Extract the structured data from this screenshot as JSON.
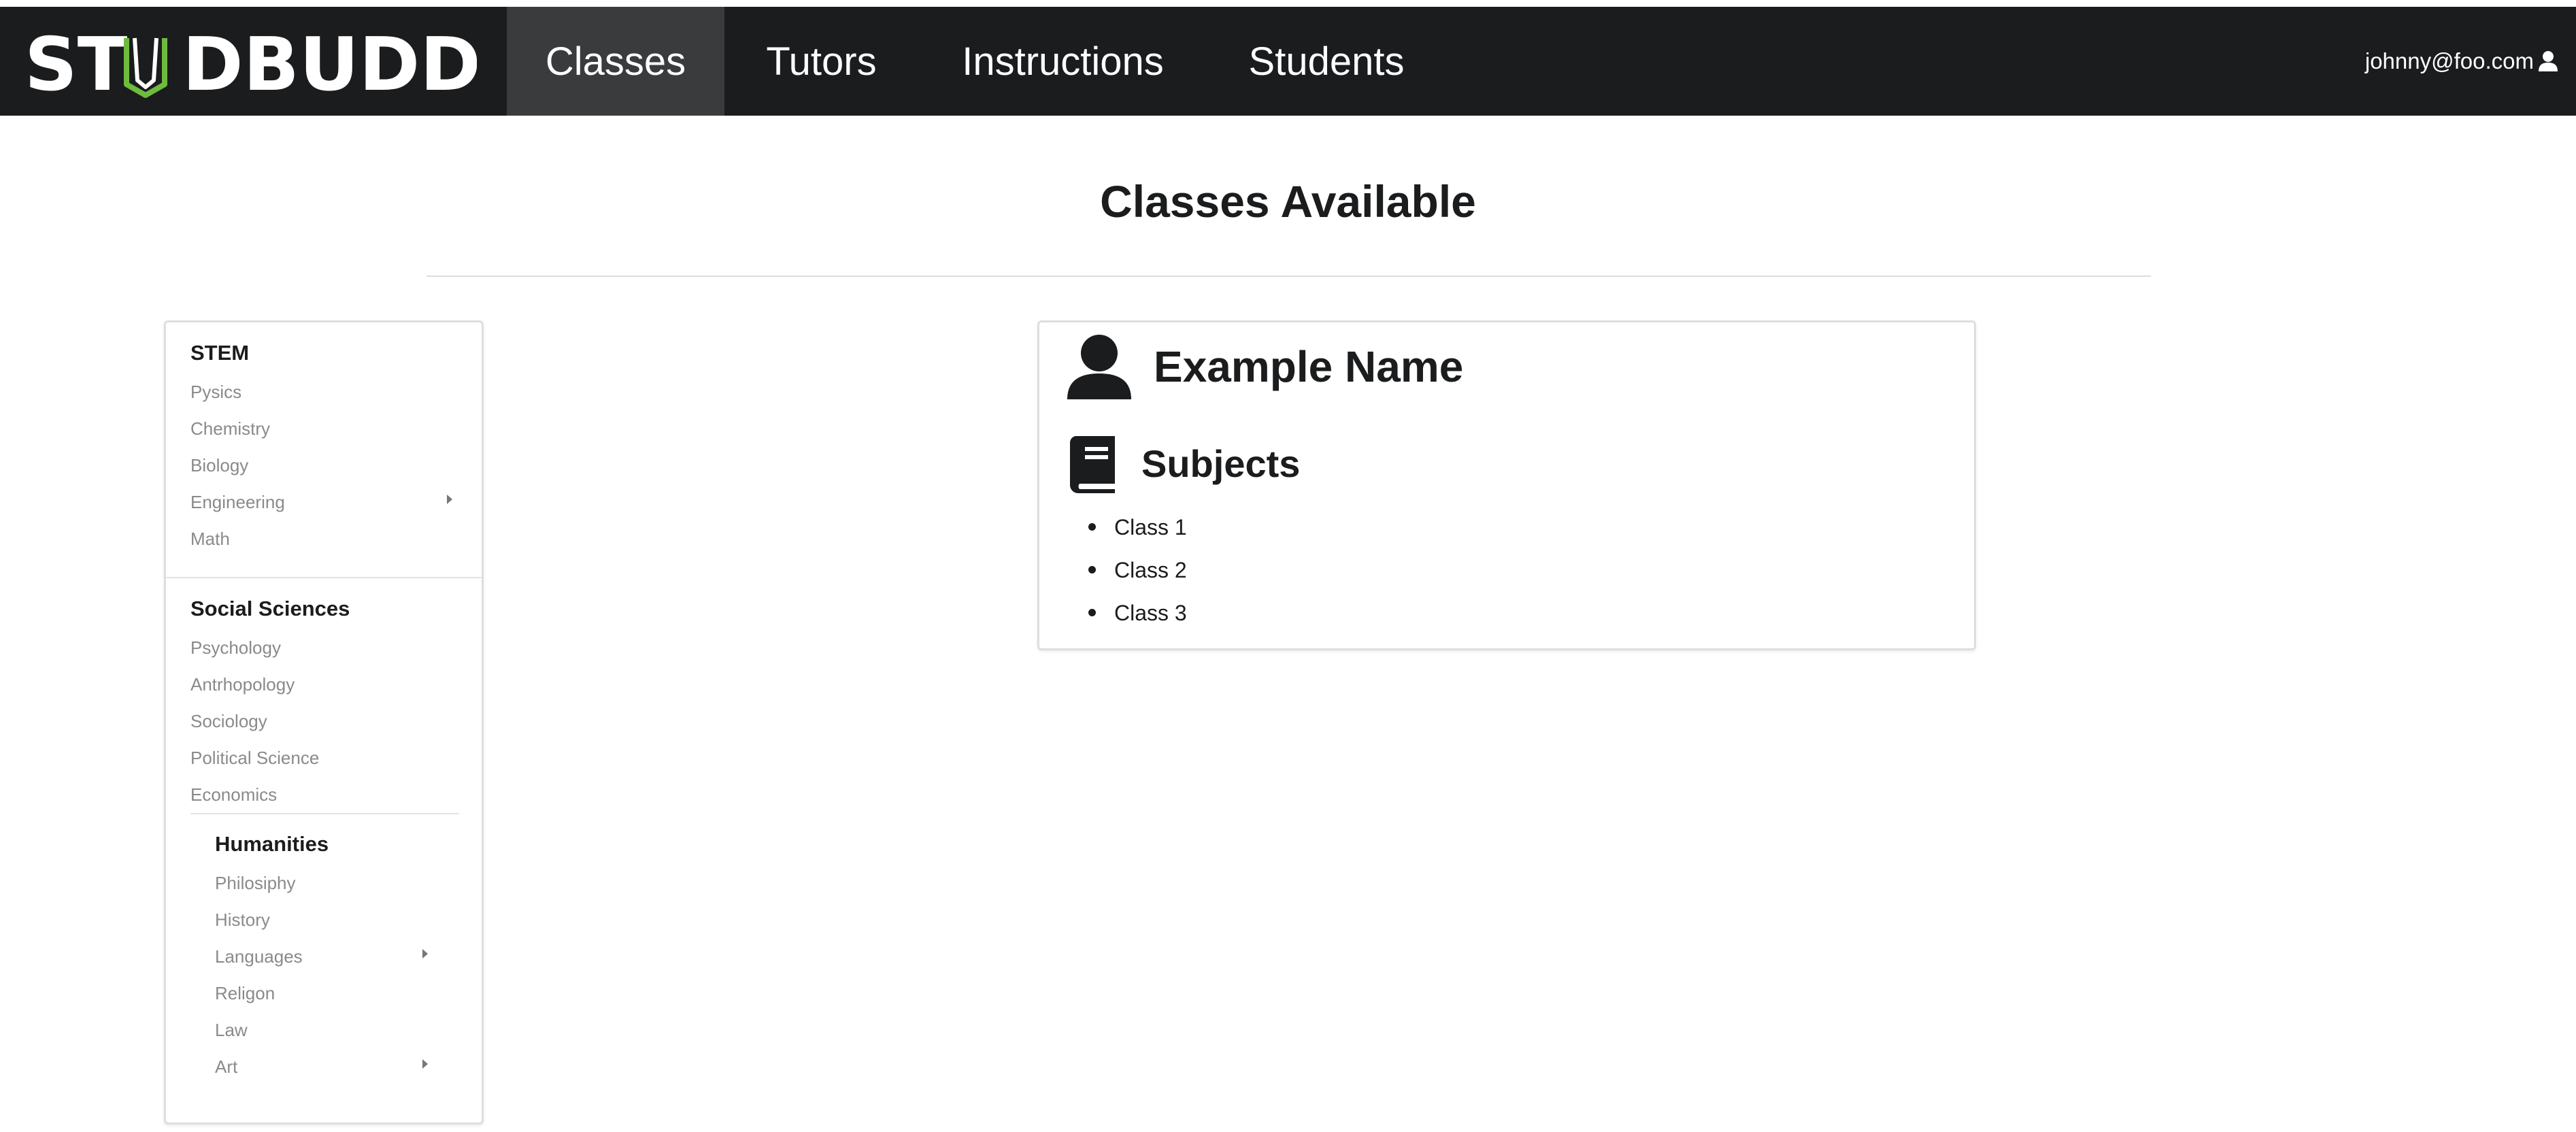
{
  "brand": {
    "logo_text": "STUDBUDD",
    "accent_color": "#6dbb3f"
  },
  "navbar": {
    "items": [
      {
        "label": "Classes",
        "active": true
      },
      {
        "label": "Tutors",
        "active": false
      },
      {
        "label": "Instructions",
        "active": false
      },
      {
        "label": "Students",
        "active": false
      }
    ],
    "user_email": "johnny@foo.com",
    "user_icon": "user-icon"
  },
  "page": {
    "title": "Classes Available"
  },
  "sidebar": {
    "groups": [
      {
        "header": "STEM",
        "items": [
          {
            "label": "Pysics",
            "has_submenu": false
          },
          {
            "label": "Chemistry",
            "has_submenu": false
          },
          {
            "label": "Biology",
            "has_submenu": false
          },
          {
            "label": "Engineering",
            "has_submenu": true
          },
          {
            "label": "Math",
            "has_submenu": false
          }
        ]
      },
      {
        "header": "Social Sciences",
        "items": [
          {
            "label": "Psychology",
            "has_submenu": false
          },
          {
            "label": "Antrhopology",
            "has_submenu": false
          },
          {
            "label": "Sociology",
            "has_submenu": false
          },
          {
            "label": "Political Science",
            "has_submenu": false
          },
          {
            "label": "Economics",
            "has_submenu": false
          }
        ]
      },
      {
        "header": "Humanities",
        "items": [
          {
            "label": "Philosiphy",
            "has_submenu": false
          },
          {
            "label": "History",
            "has_submenu": false
          },
          {
            "label": "Languages",
            "has_submenu": true
          },
          {
            "label": "Religon",
            "has_submenu": false
          },
          {
            "label": "Law",
            "has_submenu": false
          },
          {
            "label": "Art",
            "has_submenu": true
          }
        ]
      }
    ]
  },
  "card": {
    "name": "Example Name",
    "name_icon": "user-icon",
    "subjects_heading": "Subjects",
    "subjects_icon": "book-icon",
    "classes": [
      "Class 1",
      "Class 2",
      "Class 3"
    ]
  }
}
